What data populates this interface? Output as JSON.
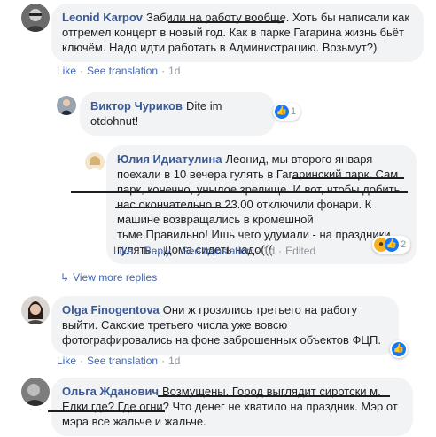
{
  "comments": [
    {
      "author": "Leonid Karpov",
      "text": "Забили на работу вообще. Хоть бы написали как отгремел концерт в новый год. Как в парке Гагарина жизнь бьёт ключём. Надо идти работать в Администрацию. Возьмут?)",
      "like": "Like",
      "translation": "See translation",
      "time": "1d"
    },
    {
      "author": "Виктор Чуриков",
      "text": "Dite im otdohnut!",
      "reactions_count": "1",
      "reaction_icon": "like-icon"
    },
    {
      "author": "Юлия Идиатулина",
      "text": "Леонид, мы второго января поехали в 10 вечера гулять в Гагаринский парк. Сам парк, конечно, унылое зрелище. И вот, чтобы добить нас окончательно в 23.00 отключили фонари. К машине возвращались в кромешной тьме.Правильно! Ишь чего удумали - на праздники гулять... Дома сидеть надо(((",
      "like": "Like",
      "reply": "Reply",
      "translation": "See translation",
      "time": "1d",
      "edited": "Edited",
      "reactions_count": "2",
      "reaction_icons": [
        "wow-icon",
        "like-icon"
      ]
    },
    {
      "author": "Olga Finogentova",
      "text": "Они ж грозились третьего на работу выйти. Сакские третьего числа уже вовсю фотографировались на фоне заброшенных объектов ФЦП.",
      "like": "Like",
      "translation": "See translation",
      "time": "1d"
    },
    {
      "author": "Ольга Жданович",
      "text": "Возмущены. Город выглядит сиротски м. Елки где? Где огни? Что денег не хватило на праздник. Мэр от мэра все жальче и жальче."
    }
  ],
  "view_more": "View more replies",
  "colors": {
    "link": "#385898",
    "action": "#4267b2",
    "meta": "#90949c",
    "bubble": "#f2f3f5",
    "like": "#1877f2"
  }
}
